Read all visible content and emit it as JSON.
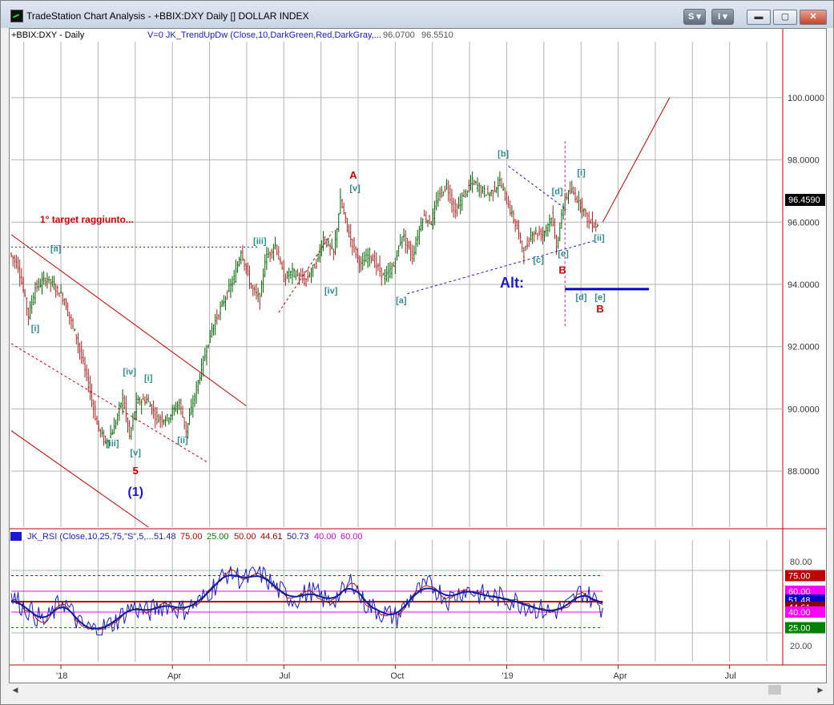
{
  "window": {
    "title": "TradeStation Chart Analysis - +BBIX:DXY Daily [] DOLLAR INDEX",
    "buttons": {
      "s": "S ▾",
      "i": "I ▾",
      "minimize": "▬",
      "maximize": "▢",
      "close": "✕"
    }
  },
  "price_panel": {
    "symbol_label": "+BBIX:DXY - Daily",
    "indicator_label": "V=0  JK_TrendUpDw (Close,10,DarkGreen,Red,DarkGray,...",
    "indicator_val1": "96.0700",
    "indicator_val2": "96.5510",
    "last_price": "96.4590",
    "target_note": "1° target raggiunto...",
    "alt_label": "Alt:"
  },
  "rsi_panel": {
    "label": "JK_RSI (Close,10,25,75,\"S\",5,...",
    "values": [
      {
        "text": "51.48",
        "color": "#1a1a9c"
      },
      {
        "text": "75.00",
        "color": "#c00000"
      },
      {
        "text": "25.00",
        "color": "#008000"
      },
      {
        "text": "50.00",
        "color": "#c00000"
      },
      {
        "text": "44.61",
        "color": "#8b0000"
      },
      {
        "text": "50.73",
        "color": "#1a1a9c"
      },
      {
        "text": "40.00",
        "color": "#d100d1"
      },
      {
        "text": "60.00",
        "color": "#d100d1"
      }
    ],
    "badges": [
      {
        "text": "75.00",
        "bg": "#c00000",
        "fg": "#ffffff",
        "level": 75
      },
      {
        "text": "60.00",
        "bg": "#ff00ff",
        "fg": "#ffffff",
        "level": 60
      },
      {
        "text": "51.48",
        "bg": "#0000cc",
        "fg": "#ffffff",
        "level": 51.48
      },
      {
        "text": "44.61",
        "bg": "#8b0000",
        "fg": "#ffffff",
        "level": 44.61
      },
      {
        "text": "40.00",
        "bg": "#ff00ff",
        "fg": "#ffffff",
        "level": 40
      },
      {
        "text": "25.00",
        "bg": "#008000",
        "fg": "#ffffff",
        "level": 25
      }
    ],
    "axis_ticks": [
      "80.00",
      "20.00"
    ]
  },
  "chart_data": {
    "type": "candlestick",
    "y_ticks": [
      "100.0000",
      "98.0000",
      "96.0000",
      "94.0000",
      "92.0000",
      "90.0000",
      "88.0000"
    ],
    "y_tick_values": [
      100,
      98,
      96,
      94,
      92,
      90,
      88
    ],
    "ylim": [
      86.2,
      101.8
    ],
    "x_ticks": [
      "'18",
      "Apr",
      "Jul",
      "Oct",
      "'19",
      "Apr",
      "Jul"
    ],
    "x_tick_index": [
      58,
      188,
      318,
      448,
      578,
      708,
      838
    ],
    "price_path": [
      [
        0,
        95.0
      ],
      [
        10,
        94.6
      ],
      [
        22,
        93.0
      ],
      [
        30,
        93.9
      ],
      [
        44,
        94.2
      ],
      [
        62,
        93.6
      ],
      [
        78,
        92.3
      ],
      [
        92,
        90.8
      ],
      [
        102,
        89.5
      ],
      [
        112,
        88.9
      ],
      [
        122,
        89.4
      ],
      [
        132,
        90.4
      ],
      [
        140,
        89.1
      ],
      [
        148,
        90.2
      ],
      [
        160,
        90.3
      ],
      [
        172,
        89.7
      ],
      [
        184,
        89.7
      ],
      [
        198,
        90.2
      ],
      [
        206,
        89.3
      ],
      [
        222,
        91.1
      ],
      [
        235,
        92.5
      ],
      [
        252,
        93.6
      ],
      [
        262,
        94.2
      ],
      [
        270,
        95.1
      ],
      [
        282,
        93.9
      ],
      [
        292,
        93.5
      ],
      [
        298,
        94.8
      ],
      [
        310,
        95.3
      ],
      [
        320,
        94.2
      ],
      [
        330,
        94.4
      ],
      [
        345,
        94.1
      ],
      [
        358,
        94.7
      ],
      [
        366,
        95.5
      ],
      [
        378,
        95.0
      ],
      [
        386,
        96.7
      ],
      [
        396,
        95.6
      ],
      [
        410,
        94.6
      ],
      [
        420,
        95.0
      ],
      [
        428,
        94.6
      ],
      [
        438,
        94.2
      ],
      [
        448,
        94.6
      ],
      [
        458,
        95.6
      ],
      [
        470,
        94.9
      ],
      [
        482,
        96.2
      ],
      [
        492,
        96.0
      ],
      [
        500,
        96.8
      ],
      [
        510,
        97.2
      ],
      [
        520,
        96.3
      ],
      [
        530,
        96.9
      ],
      [
        540,
        97.3
      ],
      [
        552,
        97.0
      ],
      [
        560,
        96.9
      ],
      [
        572,
        97.3
      ],
      [
        585,
        96.3
      ],
      [
        592,
        95.8
      ],
      [
        600,
        95.0
      ],
      [
        610,
        95.7
      ],
      [
        622,
        95.6
      ],
      [
        632,
        96.2
      ],
      [
        638,
        95.2
      ],
      [
        648,
        96.8
      ],
      [
        656,
        97.0
      ],
      [
        666,
        96.6
      ],
      [
        676,
        96.0
      ],
      [
        684,
        95.9
      ]
    ],
    "fan_lines": [
      [
        0,
        95.6,
        274,
        90.1
      ],
      [
        0,
        92.1,
        228,
        88.3
      ],
      [
        0,
        89.3,
        160,
        86.2
      ],
      [
        312,
        93.1,
        375,
        95.7
      ],
      [
        462,
        93.7,
        680,
        95.4
      ],
      [
        580,
        97.8,
        648,
        96.4
      ]
    ],
    "target_line": [
      690,
      96.0,
      768,
      100.0
    ],
    "support_line": [
      0,
      95.2,
      290,
      95.2
    ],
    "alt_level": [
      646,
      93.85,
      744,
      93.85
    ],
    "vline_index": 646,
    "waves": [
      {
        "t": "[ii]",
        "i": 52,
        "v": 95.05,
        "c": "#2e8b8b",
        "s": 11,
        "b": 0
      },
      {
        "t": "[i]",
        "i": 28,
        "v": 92.5,
        "c": "#2e8b8b",
        "s": 11,
        "b": 0
      },
      {
        "t": "[iii]",
        "i": 118,
        "v": 88.8,
        "c": "#2e8b8b",
        "s": 11,
        "b": 0
      },
      {
        "t": "[iv]",
        "i": 138,
        "v": 91.1,
        "c": "#2e8b8b",
        "s": 11,
        "b": 0
      },
      {
        "t": "[i]",
        "i": 160,
        "v": 90.9,
        "c": "#2e8b8b",
        "s": 11,
        "b": 0
      },
      {
        "t": "[v]",
        "i": 145,
        "v": 88.5,
        "c": "#2e8b8b",
        "s": 11,
        "b": 0
      },
      {
        "t": "5",
        "i": 145,
        "v": 87.9,
        "c": "#d00000",
        "s": 13,
        "b": 1
      },
      {
        "t": "(1)",
        "i": 145,
        "v": 87.2,
        "c": "#1a1acc",
        "s": 16,
        "b": 1
      },
      {
        "t": "[ii]",
        "i": 200,
        "v": 88.9,
        "c": "#2e8b8b",
        "s": 11,
        "b": 0
      },
      {
        "t": "[iii]",
        "i": 290,
        "v": 95.3,
        "c": "#2e8b8b",
        "s": 11,
        "b": 0
      },
      {
        "t": "[iv]",
        "i": 373,
        "v": 93.7,
        "c": "#2e8b8b",
        "s": 11,
        "b": 0
      },
      {
        "t": "[v]",
        "i": 401,
        "v": 97.0,
        "c": "#2e8b8b",
        "s": 11,
        "b": 0
      },
      {
        "t": "A",
        "i": 399,
        "v": 97.4,
        "c": "#d00000",
        "s": 13,
        "b": 1
      },
      {
        "t": "[a]",
        "i": 455,
        "v": 93.4,
        "c": "#2e8b8b",
        "s": 11,
        "b": 0
      },
      {
        "t": "[b]",
        "i": 574,
        "v": 98.1,
        "c": "#2e8b8b",
        "s": 11,
        "b": 0
      },
      {
        "t": "[c]",
        "i": 615,
        "v": 94.7,
        "c": "#2e8b8b",
        "s": 11,
        "b": 0
      },
      {
        "t": "[d]",
        "i": 637,
        "v": 96.9,
        "c": "#2e8b8b",
        "s": 11,
        "b": 0
      },
      {
        "t": "[e]",
        "i": 644,
        "v": 94.9,
        "c": "#2e8b8b",
        "s": 11,
        "b": 0
      },
      {
        "t": "B",
        "i": 643,
        "v": 94.35,
        "c": "#d00000",
        "s": 13,
        "b": 1
      },
      {
        "t": "[i]",
        "i": 665,
        "v": 97.5,
        "c": "#2e8b8b",
        "s": 11,
        "b": 0
      },
      {
        "t": "[ii]",
        "i": 686,
        "v": 95.4,
        "c": "#2e8b8b",
        "s": 11,
        "b": 0
      },
      {
        "t": "[d]",
        "i": 665,
        "v": 93.5,
        "c": "#2e8b8b",
        "s": 11,
        "b": 0
      },
      {
        "t": "[e]",
        "i": 687,
        "v": 93.5,
        "c": "#2e8b8b",
        "s": 11,
        "b": 0
      },
      {
        "t": "B",
        "i": 687,
        "v": 93.1,
        "c": "#d00000",
        "s": 13,
        "b": 1
      }
    ],
    "rsi_path": [
      [
        0,
        55
      ],
      [
        20,
        42
      ],
      [
        40,
        30
      ],
      [
        60,
        52
      ],
      [
        80,
        28
      ],
      [
        100,
        22
      ],
      [
        120,
        30
      ],
      [
        140,
        45
      ],
      [
        160,
        40
      ],
      [
        180,
        48
      ],
      [
        200,
        42
      ],
      [
        220,
        50
      ],
      [
        240,
        68
      ],
      [
        255,
        80
      ],
      [
        270,
        70
      ],
      [
        290,
        78
      ],
      [
        310,
        62
      ],
      [
        330,
        52
      ],
      [
        350,
        60
      ],
      [
        370,
        50
      ],
      [
        390,
        60
      ],
      [
        398,
        72
      ],
      [
        410,
        50
      ],
      [
        430,
        40
      ],
      [
        450,
        35
      ],
      [
        470,
        58
      ],
      [
        490,
        66
      ],
      [
        510,
        52
      ],
      [
        530,
        62
      ],
      [
        550,
        56
      ],
      [
        570,
        54
      ],
      [
        590,
        50
      ],
      [
        610,
        44
      ],
      [
        630,
        40
      ],
      [
        650,
        46
      ],
      [
        665,
        60
      ],
      [
        680,
        52
      ],
      [
        690,
        44
      ]
    ]
  }
}
